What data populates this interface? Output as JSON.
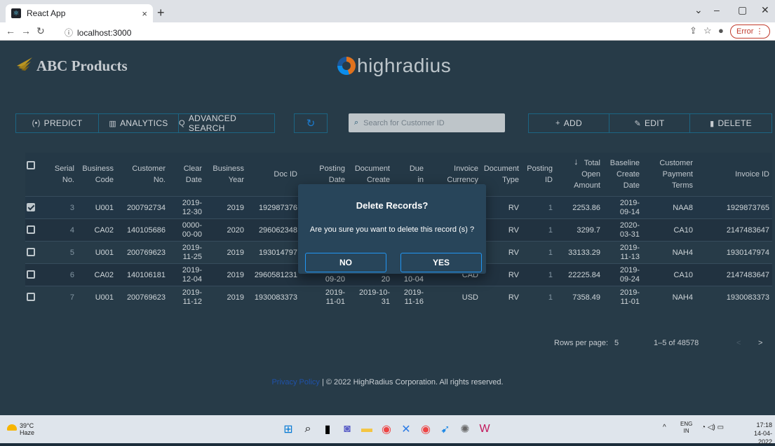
{
  "browser": {
    "tab_title": "React App",
    "tab_close": "×",
    "new_tab": "+",
    "url": "localhost:3000",
    "error_label": "Error"
  },
  "app": {
    "brand": "ABC Products",
    "partner_logo": "highradius",
    "toolbar_left": [
      {
        "icon": "(•)",
        "label": "PREDICT"
      },
      {
        "icon": "▥",
        "label": "ANALYTICS"
      },
      {
        "icon": "Q",
        "label": "ADVANCED SEARCH"
      }
    ],
    "refresh_icon": "↻",
    "search_placeholder": "Search for Customer ID",
    "toolbar_right": [
      {
        "icon": "+",
        "label": "ADD"
      },
      {
        "icon": "✎",
        "label": "EDIT"
      },
      {
        "icon": "▮",
        "label": "DELETE"
      }
    ]
  },
  "table": {
    "headers": [
      [
        "Serial",
        "No."
      ],
      [
        "Business",
        "Code"
      ],
      [
        "Customer",
        "No."
      ],
      [
        "Clear",
        "Date"
      ],
      [
        "Business",
        "Year"
      ],
      [
        "Doc ID"
      ],
      [
        "Posting",
        "Date"
      ],
      [
        "Document",
        "Create"
      ],
      [
        "Due",
        "in"
      ],
      [
        "Invoice",
        "Currency"
      ],
      [
        "Document",
        "Type"
      ],
      [
        "Posting",
        "ID"
      ],
      [
        "Total",
        "Open",
        "Amount"
      ],
      [
        "Baseline",
        "Create",
        "Date"
      ],
      [
        "Customer",
        "Payment",
        "Terms"
      ],
      [
        "Invoice ID"
      ]
    ],
    "sort_icon": "↓",
    "rows": [
      {
        "checked": true,
        "cells": [
          "3",
          "U001",
          "200792734",
          [
            "2019-",
            "12-30"
          ],
          "2019",
          "192987376",
          "",
          "",
          "",
          "",
          "RV",
          "1",
          "2253.86",
          [
            "2019-",
            "09-14"
          ],
          "NAA8",
          "1929873765"
        ]
      },
      {
        "checked": false,
        "cells": [
          "4",
          "CA02",
          "140105686",
          [
            "0000-",
            "00-00"
          ],
          "2020",
          "296062348",
          "",
          "",
          "",
          "",
          "RV",
          "1",
          "3299.7",
          [
            "2020-",
            "03-31"
          ],
          "CA10",
          "2147483647"
        ]
      },
      {
        "checked": false,
        "cells": [
          "5",
          "U001",
          "200769623",
          [
            "2019-",
            "11-25"
          ],
          "2019",
          "193014797",
          "",
          "",
          "",
          "",
          "RV",
          "1",
          "33133.29",
          [
            "2019-",
            "11-13"
          ],
          "NAH4",
          "1930147974"
        ]
      },
      {
        "checked": false,
        "cells": [
          "6",
          "CA02",
          "140106181",
          [
            "2019-",
            "12-04"
          ],
          "2019",
          "2960581231",
          [
            "2019-",
            "09-20"
          ],
          [
            "2019-09-",
            "20"
          ],
          [
            "2019-",
            "10-04"
          ],
          "CAD",
          "RV",
          "1",
          "22225.84",
          [
            "2019-",
            "09-24"
          ],
          "CA10",
          "2147483647"
        ]
      },
      {
        "checked": false,
        "cells": [
          "7",
          "U001",
          "200769623",
          [
            "2019-",
            "11-12"
          ],
          "2019",
          "1930083373",
          [
            "2019-",
            "11-01"
          ],
          [
            "2019-10-",
            "31"
          ],
          [
            "2019-",
            "11-16"
          ],
          "USD",
          "RV",
          "1",
          "7358.49",
          [
            "2019-",
            "11-01"
          ],
          "NAH4",
          "1930083373"
        ]
      }
    ]
  },
  "pagination": {
    "rows_per_page_label": "Rows per page:",
    "rows_per_page": "5",
    "range": "1–5 of 48578",
    "prev": "<",
    "next": ">"
  },
  "footer": {
    "link": "Privacy Policy",
    "text": " | © 2022 HighRadius Corporation. All rights reserved."
  },
  "dialog": {
    "title": "Delete Records?",
    "message": "Are you sure you want to delete this record (s) ?",
    "no_label": "NO",
    "yes_label": "YES"
  },
  "taskbar": {
    "temp": "39°C",
    "weather": "Haze",
    "lang_top": "ENG",
    "lang_bottom": "IN",
    "time": "17:18",
    "date": "14-04-2022"
  },
  "colors": {
    "app_bg": "#2b404f",
    "accent": "#2196f3",
    "dialog_bg": "#28455a"
  }
}
